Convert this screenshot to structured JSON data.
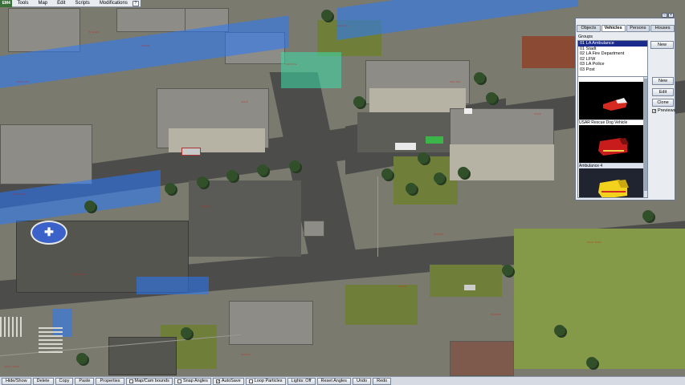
{
  "menubar": {
    "logo": "EM4",
    "items": [
      "Tools",
      "Map",
      "Edit",
      "Scripts",
      "Modifications"
    ],
    "help": "?"
  },
  "panel": {
    "tabs": [
      "Objects",
      "Vehicles",
      "Persons",
      "Houses"
    ],
    "active_tab": "Vehicles",
    "groups_label": "Groups",
    "groups": [
      "01 LA Ambulance",
      "01 Stadt",
      "02 LA Fire Department",
      "02 LFW",
      "03 LA Police",
      "03 Post"
    ],
    "selected_group": "01 LA Ambulance",
    "new_group_button": "New",
    "vehicles": [
      {
        "name": "",
        "color": "#d52a20"
      },
      {
        "name": "USAR Rescue Dog Vehicle",
        "color": "#c81c1c"
      },
      {
        "name": "Ambulance 4",
        "color": "#f2d21c"
      }
    ],
    "buttons": {
      "new": "New",
      "edit": "Edit",
      "clone": "Clone"
    },
    "previews_label": "Previews",
    "previews_checked": true
  },
  "toolbar": {
    "hide_show": "Hide/Show",
    "delete": "Delete",
    "copy": "Copy",
    "paste": "Paste",
    "properties": "Properties",
    "map_cam_bounds": "Map/Cam bounds",
    "snap_angles": "Snap Angles",
    "autosave": "AutoSave",
    "loop_particles": "Loop Particles",
    "lights_off": "Lights: Off",
    "reset_angles": "Reset Angles",
    "undo": "Undo",
    "redo": "Redo"
  }
}
